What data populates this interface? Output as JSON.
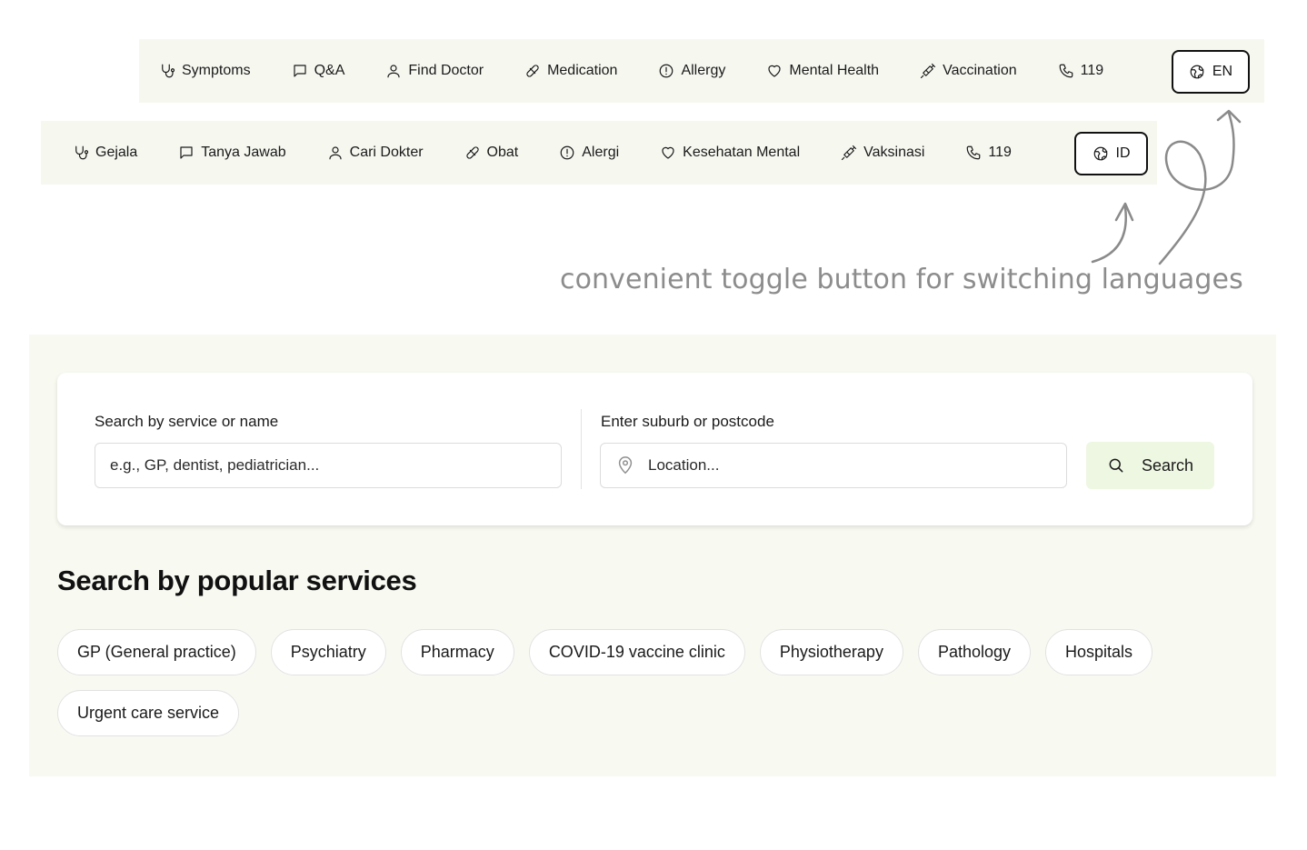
{
  "nav_en": {
    "items": [
      {
        "label": "Symptoms",
        "icon": "stethoscope-icon"
      },
      {
        "label": "Q&A",
        "icon": "chat-icon"
      },
      {
        "label": "Find Doctor",
        "icon": "user-icon"
      },
      {
        "label": "Medication",
        "icon": "pill-icon"
      },
      {
        "label": "Allergy",
        "icon": "alert-circle-icon"
      },
      {
        "label": "Mental Health",
        "icon": "heart-icon"
      },
      {
        "label": "Vaccination",
        "icon": "syringe-icon"
      },
      {
        "label": "119",
        "icon": "phone-icon"
      }
    ],
    "lang_label": "EN"
  },
  "nav_id": {
    "items": [
      {
        "label": "Gejala",
        "icon": "stethoscope-icon"
      },
      {
        "label": "Tanya Jawab",
        "icon": "chat-icon"
      },
      {
        "label": "Cari Dokter",
        "icon": "user-icon"
      },
      {
        "label": "Obat",
        "icon": "pill-icon"
      },
      {
        "label": "Alergi",
        "icon": "alert-circle-icon"
      },
      {
        "label": "Kesehatan Mental",
        "icon": "heart-icon"
      },
      {
        "label": "Vaksinasi",
        "icon": "syringe-icon"
      },
      {
        "label": "119",
        "icon": "phone-icon"
      }
    ],
    "lang_label": "ID"
  },
  "annotation": "convenient toggle button for switching languages",
  "search": {
    "service_label": "Search by service or name",
    "service_placeholder": "e.g., GP, dentist, pediatrician...",
    "location_label": "Enter suburb or postcode",
    "location_placeholder": "Location...",
    "button_label": "Search"
  },
  "popular": {
    "title": "Search by popular services",
    "chips": [
      "GP (General practice)",
      "Psychiatry",
      "Pharmacy",
      "COVID-19 vaccine clinic",
      "Physiotherapy",
      "Pathology",
      "Hospitals",
      "Urgent care service"
    ]
  },
  "colors": {
    "nav_bg": "#f6f8f0",
    "panel_bg": "#f8faf2",
    "search_button_bg": "#eef7e2",
    "annotation_text": "#8c8c8c"
  }
}
